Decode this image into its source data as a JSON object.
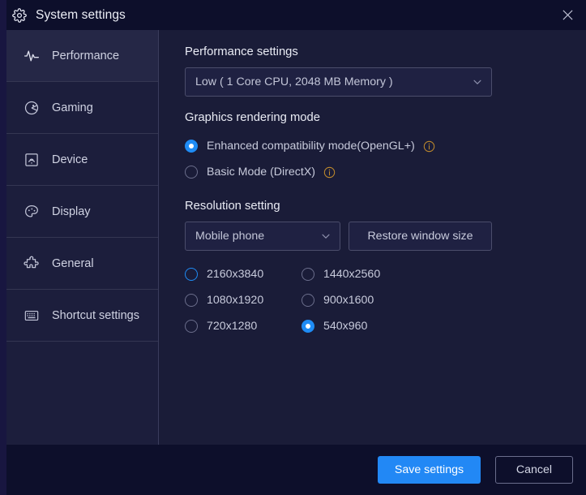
{
  "window": {
    "title": "System settings",
    "gear_icon": "gear-icon",
    "close_icon": "close-icon"
  },
  "colors": {
    "accent": "#2288f5",
    "radio_selected": "#1f8cf5",
    "info_icon": "#c08a2c",
    "titlebar_bg": "#0d0f2b",
    "sidebar_bg": "#1c1e3c",
    "sidebar_active_bg": "#252746",
    "content_bg": "#1a1c38",
    "control_bg": "#1f2142",
    "control_border": "#4b4d6b"
  },
  "sidebar": {
    "items": [
      {
        "label": "Performance",
        "icon": "activity-pulse-icon",
        "active": true
      },
      {
        "label": "Gaming",
        "icon": "gamepad-icon",
        "active": false
      },
      {
        "label": "Device",
        "icon": "device-monitor-icon",
        "active": false
      },
      {
        "label": "Display",
        "icon": "palette-icon",
        "active": false
      },
      {
        "label": "General",
        "icon": "puzzle-piece-icon",
        "active": false
      },
      {
        "label": "Shortcut settings",
        "icon": "keyboard-icon",
        "active": false
      }
    ]
  },
  "main": {
    "performance": {
      "section_title": "Performance settings",
      "dropdown_value": "Low ( 1 Core CPU, 2048 MB Memory )",
      "dropdown_icon": "chevron-down-icon"
    },
    "graphics": {
      "section_title": "Graphics rendering mode",
      "options": [
        {
          "label": "Enhanced compatibility mode(OpenGL+)",
          "selected": true,
          "info_icon": "info-icon"
        },
        {
          "label": "Basic Mode (DirectX)",
          "selected": false,
          "info_icon": "info-icon"
        }
      ]
    },
    "resolution": {
      "section_title": "Resolution setting",
      "type_dropdown_value": "Mobile phone",
      "type_dropdown_icon": "chevron-down-icon",
      "restore_button_label": "Restore window size",
      "options": [
        {
          "label": "2160x3840",
          "selected": false,
          "focused": true
        },
        {
          "label": "1440x2560",
          "selected": false,
          "focused": false
        },
        {
          "label": "1080x1920",
          "selected": false,
          "focused": false
        },
        {
          "label": "900x1600",
          "selected": false,
          "focused": false
        },
        {
          "label": "720x1280",
          "selected": false,
          "focused": false
        },
        {
          "label": "540x960",
          "selected": true,
          "focused": false
        }
      ]
    }
  },
  "footer": {
    "save_label": "Save settings",
    "cancel_label": "Cancel"
  }
}
